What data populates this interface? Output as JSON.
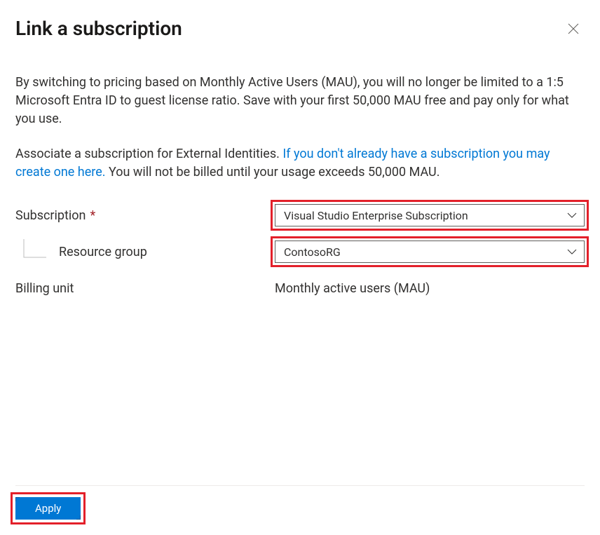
{
  "header": {
    "title": "Link a subscription"
  },
  "intro": "By switching to pricing based on Monthly Active Users (MAU), you will no longer be limited to a 1:5 Microsoft Entra ID to guest license ratio. Save with your first 50,000 MAU free and pay only for what you use.",
  "associate": {
    "prefix": "Associate a subscription for External Identities. ",
    "link": "If you don't already have a subscription you may create one here.",
    "suffix": " You will not be billed until your usage exceeds 50,000 MAU."
  },
  "fields": {
    "subscription": {
      "label": "Subscription",
      "required_marker": "*",
      "value": "Visual Studio Enterprise Subscription"
    },
    "resource_group": {
      "label": "Resource group",
      "value": "ContosoRG"
    },
    "billing_unit": {
      "label": "Billing unit",
      "value": "Monthly active users (MAU)"
    }
  },
  "footer": {
    "apply_label": "Apply"
  }
}
